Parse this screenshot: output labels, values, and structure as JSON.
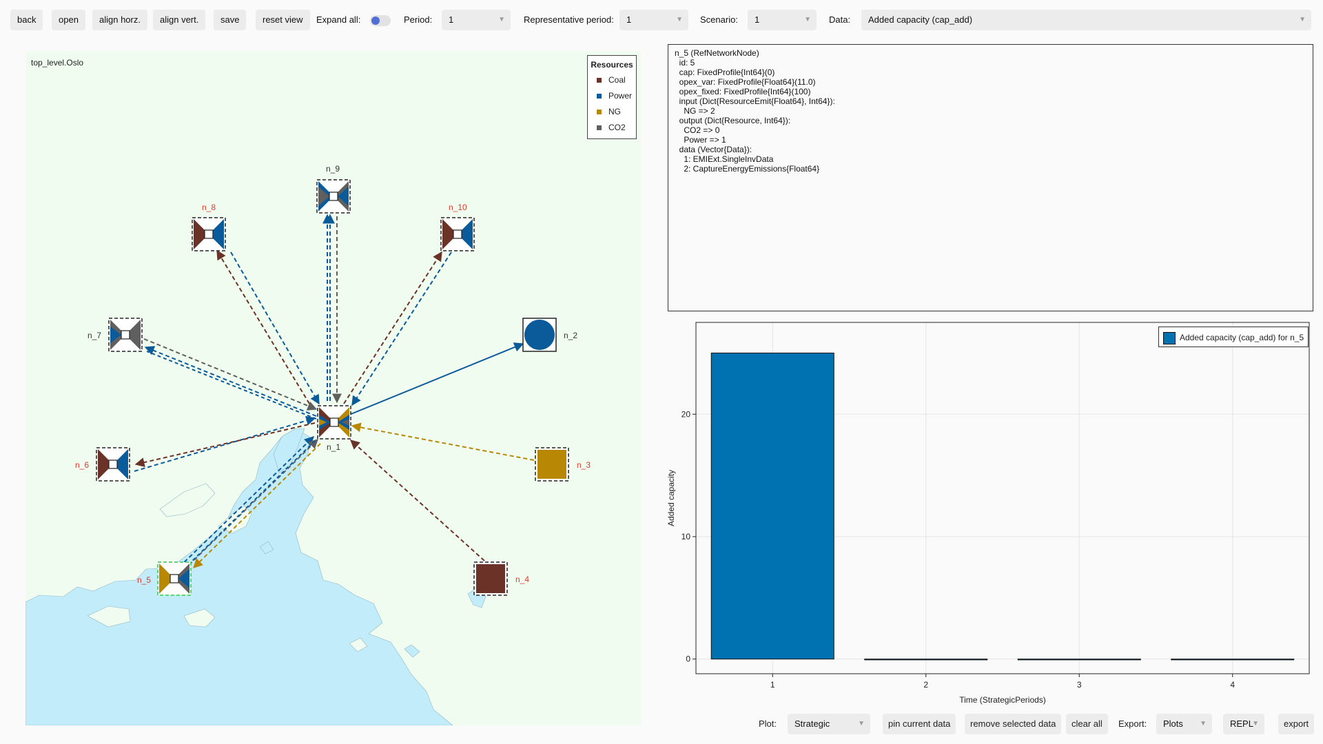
{
  "toolbar": {
    "back": "back",
    "open": "open",
    "align_horz": "align horz.",
    "align_vert": "align vert.",
    "save": "save",
    "reset_view": "reset view",
    "expand_all_label": "Expand all:",
    "expand_all_on": true,
    "period_label": "Period:",
    "period_value": "1",
    "rep_period_label": "Representative period:",
    "rep_period_value": "1",
    "scenario_label": "Scenario:",
    "scenario_value": "1",
    "data_label": "Data:",
    "data_value": "Added capacity (cap_add)"
  },
  "map": {
    "title": "top_level.Oslo",
    "legend": {
      "title": "Resources",
      "items": [
        {
          "name": "Coal",
          "color": "#6b3328"
        },
        {
          "name": "Power",
          "color": "#0b5a99"
        },
        {
          "name": "NG",
          "color": "#b88805"
        },
        {
          "name": "CO2",
          "color": "#5f5f5f"
        }
      ]
    },
    "nodes": {
      "n_1": "n_1",
      "n_2": "n_2",
      "n_3": "n_3",
      "n_4": "n_4",
      "n_5": "n_5",
      "n_6": "n_6",
      "n_7": "n_7",
      "n_8": "n_8",
      "n_9": "n_9",
      "n_10": "n_10"
    }
  },
  "info": {
    "lines": [
      "n_5 (RefNetworkNode)",
      "  id: 5",
      "  cap: FixedProfile{Int64}(0)",
      "  opex_var: FixedProfile{Float64}(11.0)",
      "  opex_fixed: FixedProfile{Int64}(100)",
      "  input (Dict{ResourceEmit{Float64}, Int64}):",
      "    NG => 2",
      "  output (Dict{Resource, Int64}):",
      "    CO2 => 0",
      "    Power => 1",
      "  data (Vector{Data}):",
      "    1: EMIExt.SingleInvData",
      "    2: CaptureEnergyEmissions{Float64}"
    ]
  },
  "chart_data": {
    "type": "bar",
    "categories": [
      "1",
      "2",
      "3",
      "4"
    ],
    "values": [
      25,
      0,
      0,
      0
    ],
    "xlabel": "Time (StrategicPeriods)",
    "ylabel": "Added capacity",
    "yticks": [
      0,
      10,
      20
    ],
    "ylim": [
      -1.2,
      27.5
    ],
    "grid": true,
    "legend_position": "top-right",
    "series": [
      {
        "name": "Added capacity (cap_add) for n_5",
        "values": [
          25,
          0,
          0,
          0
        ],
        "color": "#0072b2"
      }
    ]
  },
  "bottom": {
    "plot_label": "Plot:",
    "plot_value": "Strategic",
    "pin": "pin current data",
    "remove": "remove selected data",
    "clear": "clear all",
    "export_label": "Export:",
    "export_format": "Plots",
    "export_target": "REPL",
    "export": "export"
  }
}
